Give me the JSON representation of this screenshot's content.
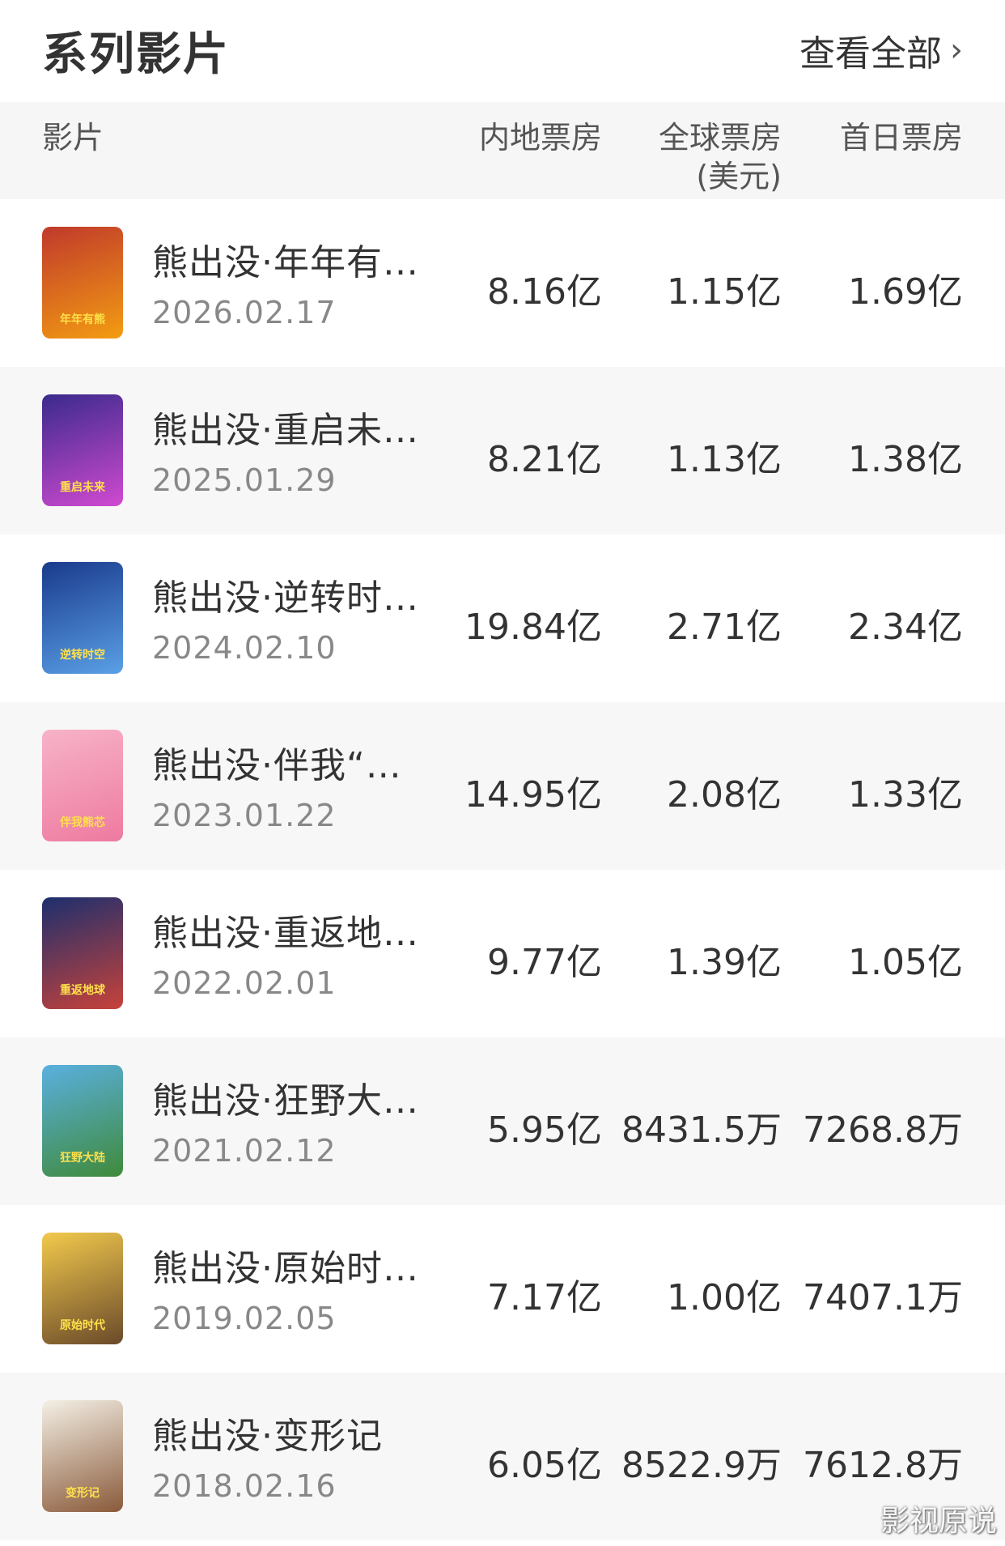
{
  "header": {
    "title": "系列影片",
    "view_all": "查看全部"
  },
  "columns": {
    "film": "影片",
    "domestic": "内地票房",
    "global_line1": "全球票房",
    "global_line2": "(美元)",
    "first_day": "首日票房"
  },
  "films": [
    {
      "title": "熊出没·年年有…",
      "date": "2026.02.17",
      "domestic": "8.16亿",
      "global": "1.15亿",
      "first_day": "1.69亿",
      "poster_colors": [
        "#c0392b",
        "#f39c12"
      ],
      "poster_text": "年年有熊"
    },
    {
      "title": "熊出没·重启未…",
      "date": "2025.01.29",
      "domestic": "8.21亿",
      "global": "1.13亿",
      "first_day": "1.38亿",
      "poster_colors": [
        "#3a2a8c",
        "#d04ad0"
      ],
      "poster_text": "重启未来"
    },
    {
      "title": "熊出没·逆转时…",
      "date": "2024.02.10",
      "domestic": "19.84亿",
      "global": "2.71亿",
      "first_day": "2.34亿",
      "poster_colors": [
        "#1a3a8c",
        "#5aa0e6"
      ],
      "poster_text": "逆转时空"
    },
    {
      "title": "熊出没·伴我“…",
      "date": "2023.01.22",
      "domestic": "14.95亿",
      "global": "2.08亿",
      "first_day": "1.33亿",
      "poster_colors": [
        "#f7b3c8",
        "#ee7aa0"
      ],
      "poster_text": "伴我熊芯"
    },
    {
      "title": "熊出没·重返地…",
      "date": "2022.02.01",
      "domestic": "9.77亿",
      "global": "1.39亿",
      "first_day": "1.05亿",
      "poster_colors": [
        "#1c2f6e",
        "#c7423a"
      ],
      "poster_text": "重返地球"
    },
    {
      "title": "熊出没·狂野大…",
      "date": "2021.02.12",
      "domestic": "5.95亿",
      "global": "8431.5万",
      "first_day": "7268.8万",
      "poster_colors": [
        "#5ab0e0",
        "#3f8a3a"
      ],
      "poster_text": "狂野大陆"
    },
    {
      "title": "熊出没·原始时…",
      "date": "2019.02.05",
      "domestic": "7.17亿",
      "global": "1.00亿",
      "first_day": "7407.1万",
      "poster_colors": [
        "#f2c94c",
        "#6a4a2a"
      ],
      "poster_text": "原始时代"
    },
    {
      "title": "熊出没·变形记",
      "date": "2018.02.16",
      "domestic": "6.05亿",
      "global": "8522.9万",
      "first_day": "7612.8万",
      "poster_colors": [
        "#f4f0e6",
        "#8a5a3a"
      ],
      "poster_text": "变形记"
    }
  ],
  "watermark": "影视原说"
}
